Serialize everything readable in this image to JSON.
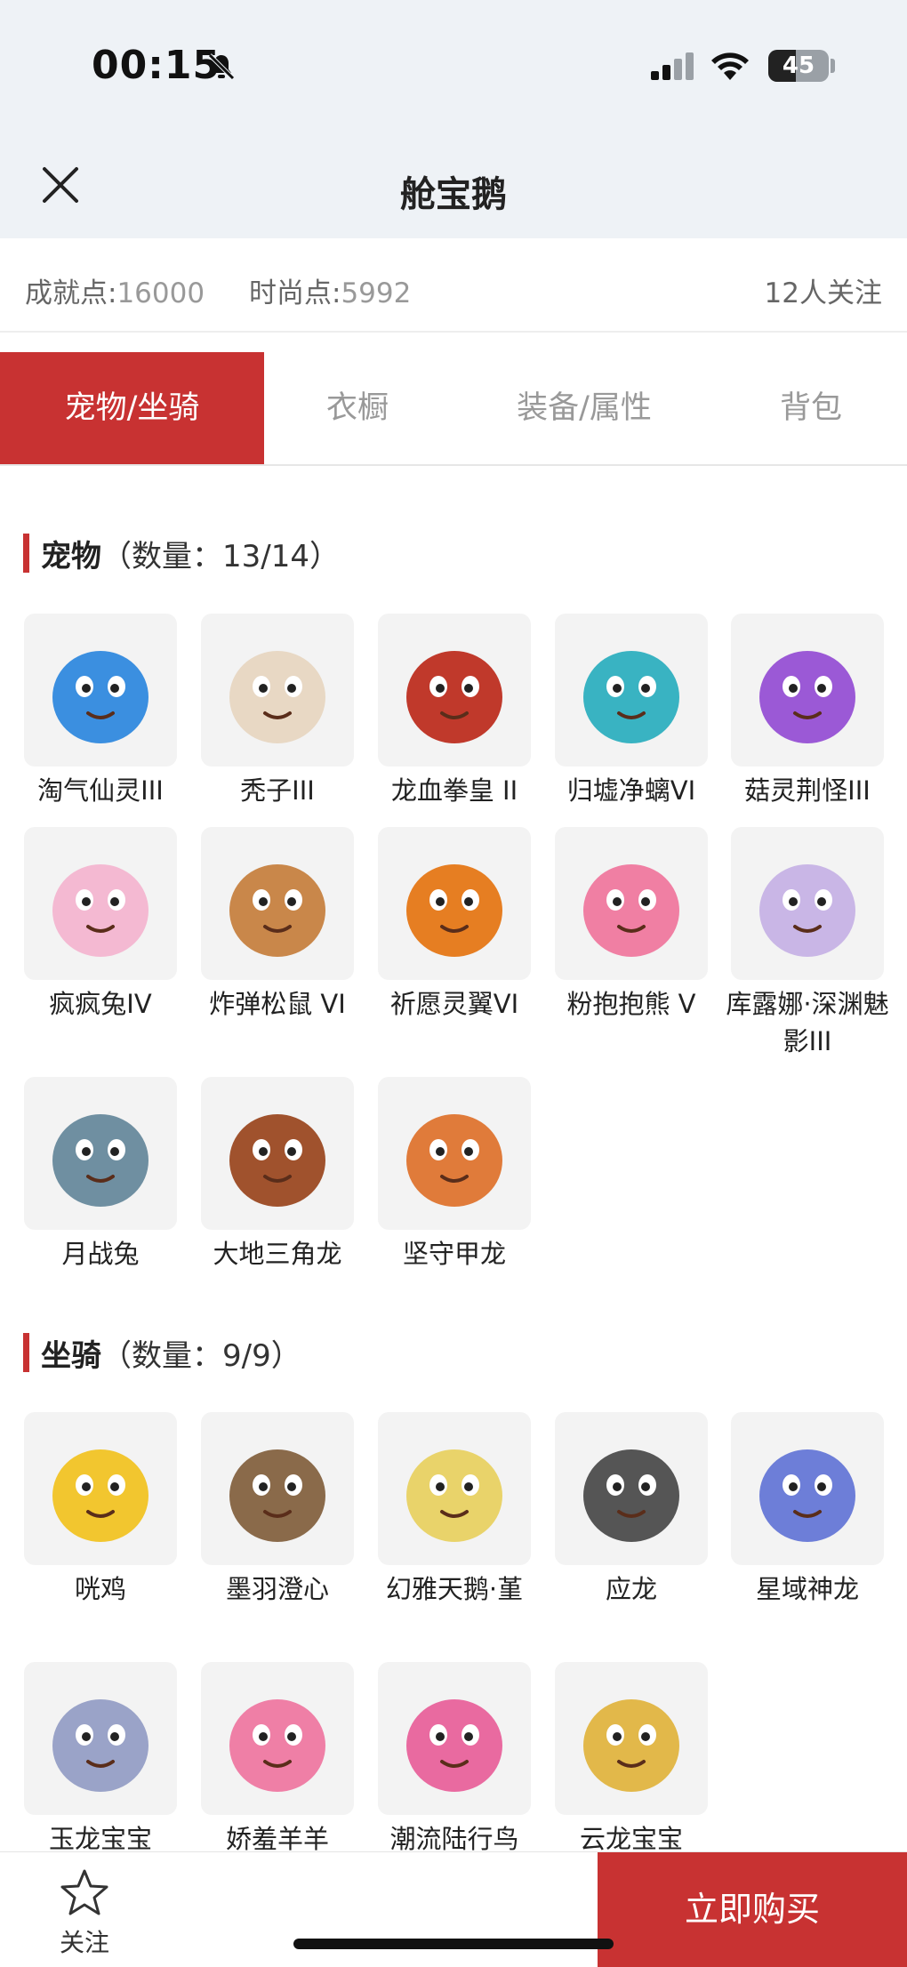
{
  "status_bar": {
    "time": "00:15",
    "battery": "45",
    "battery_fraction": 0.45
  },
  "nav": {
    "title": "舱宝鹅"
  },
  "header": {
    "achievement_label": "成就点:",
    "achievement_value": "16000",
    "fashion_label": "时尚点:",
    "fashion_value": "5992",
    "followers": "12人关注"
  },
  "tabs": [
    {
      "label": "宠物/坐骑"
    },
    {
      "label": "衣橱"
    },
    {
      "label": "装备/属性"
    },
    {
      "label": "背包"
    }
  ],
  "pets": {
    "title": "宠物",
    "count": "（数量：13/14）",
    "items": [
      {
        "label": "淘气仙灵III",
        "color": "#3b8fe0"
      },
      {
        "label": "秃子III",
        "color": "#e8d8c4"
      },
      {
        "label": "龙血拳皇 II",
        "color": "#c0392b"
      },
      {
        "label": "归墟净螭VI",
        "color": "#39b3c2"
      },
      {
        "label": "菇灵荆怪III",
        "color": "#9b59d6"
      },
      {
        "label": "疯疯兔IV",
        "color": "#f4b9d2"
      },
      {
        "label": "炸弹松鼠 VI",
        "color": "#c9874a"
      },
      {
        "label": "祈愿灵翼VI",
        "color": "#e67e22"
      },
      {
        "label": "粉抱抱熊 V",
        "color": "#f07fa3"
      },
      {
        "label": "库露娜·深渊魅影III",
        "color": "#c9b6e6"
      },
      {
        "label": "月战兔",
        "color": "#6f8fa1"
      },
      {
        "label": "大地三角龙",
        "color": "#a0522d"
      },
      {
        "label": "坚守甲龙",
        "color": "#e07b3a"
      }
    ]
  },
  "mounts": {
    "title": "坐骑",
    "count": "（数量：9/9）",
    "items": [
      {
        "label": "咣鸡",
        "color": "#f2c62f"
      },
      {
        "label": "墨羽澄心",
        "color": "#8a6a4a"
      },
      {
        "label": "幻雅天鹅·堇",
        "color": "#e9d36a"
      },
      {
        "label": "应龙",
        "color": "#555555"
      },
      {
        "label": "星域神龙",
        "color": "#6d7ed8"
      },
      {
        "label": "玉龙宝宝",
        "color": "#9aa3c8"
      },
      {
        "label": "娇羞羊羊",
        "color": "#ef7fa6"
      },
      {
        "label": "潮流陆行鸟",
        "color": "#e96aa0"
      },
      {
        "label": "云龙宝宝",
        "color": "#e2b84a"
      }
    ]
  },
  "bottom_bar": {
    "follow_label": "关注",
    "buy_label": "立即购买"
  },
  "colors": {
    "accent": "#c83232",
    "tab_inactive": "#999999",
    "nav_bg": "#eef2f6"
  }
}
